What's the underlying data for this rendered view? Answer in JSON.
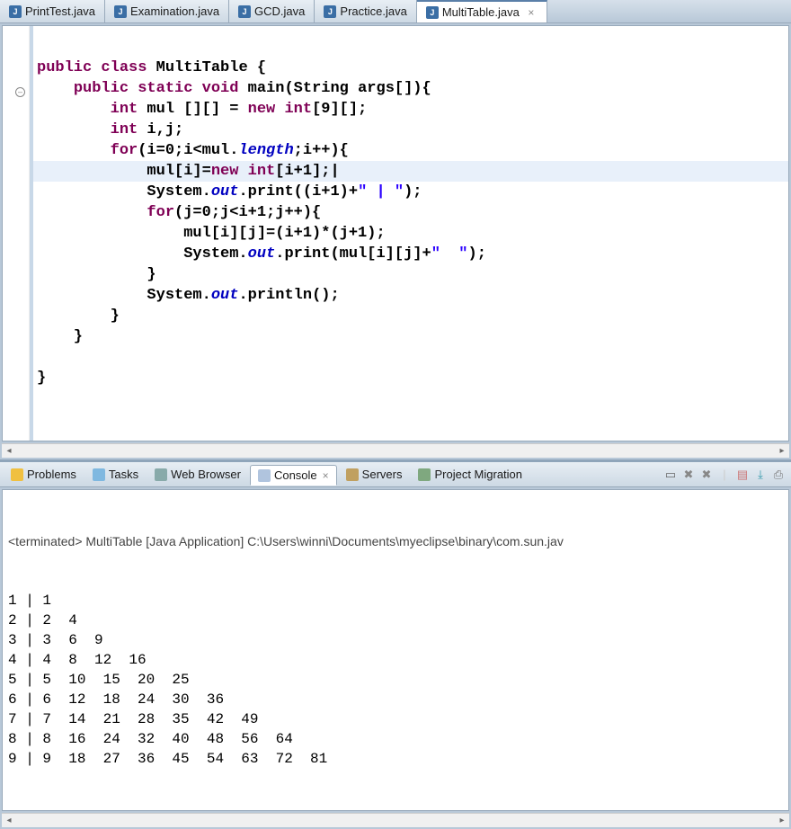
{
  "editor_tabs": [
    {
      "label": "PrintTest.java",
      "active": false
    },
    {
      "label": "Examination.java",
      "active": false
    },
    {
      "label": "GCD.java",
      "active": false
    },
    {
      "label": "Practice.java",
      "active": false
    },
    {
      "label": "MultiTable.java",
      "active": true
    }
  ],
  "code": {
    "lines": [
      [
        {
          "t": "plain",
          "s": ""
        }
      ],
      [
        {
          "t": "kw",
          "s": "public"
        },
        {
          "t": "plain",
          "s": " "
        },
        {
          "t": "kw",
          "s": "class"
        },
        {
          "t": "plain",
          "s": " MultiTable {"
        }
      ],
      [
        {
          "t": "plain",
          "s": "    "
        },
        {
          "t": "kw",
          "s": "public"
        },
        {
          "t": "plain",
          "s": " "
        },
        {
          "t": "kw",
          "s": "static"
        },
        {
          "t": "plain",
          "s": " "
        },
        {
          "t": "kw",
          "s": "void"
        },
        {
          "t": "plain",
          "s": " main(String args[]){"
        }
      ],
      [
        {
          "t": "plain",
          "s": "        "
        },
        {
          "t": "kw",
          "s": "int"
        },
        {
          "t": "plain",
          "s": " mul [][] = "
        },
        {
          "t": "kw",
          "s": "new"
        },
        {
          "t": "plain",
          "s": " "
        },
        {
          "t": "kw",
          "s": "int"
        },
        {
          "t": "plain",
          "s": "[9][];"
        }
      ],
      [
        {
          "t": "plain",
          "s": "        "
        },
        {
          "t": "kw",
          "s": "int"
        },
        {
          "t": "plain",
          "s": " i,j;"
        }
      ],
      [
        {
          "t": "plain",
          "s": "        "
        },
        {
          "t": "kw",
          "s": "for"
        },
        {
          "t": "plain",
          "s": "(i=0;i<mul."
        },
        {
          "t": "fld",
          "s": "length"
        },
        {
          "t": "plain",
          "s": ";i++){"
        }
      ],
      [
        {
          "t": "plain",
          "s": "            mul[i]="
        },
        {
          "t": "kw",
          "s": "new"
        },
        {
          "t": "plain",
          "s": " "
        },
        {
          "t": "kw",
          "s": "int"
        },
        {
          "t": "plain",
          "s": "[i+1];|"
        }
      ],
      [
        {
          "t": "plain",
          "s": "            System."
        },
        {
          "t": "fld",
          "s": "out"
        },
        {
          "t": "plain",
          "s": ".print((i+1)+"
        },
        {
          "t": "str",
          "s": "\" | \""
        },
        {
          "t": "plain",
          "s": ");"
        }
      ],
      [
        {
          "t": "plain",
          "s": "            "
        },
        {
          "t": "kw",
          "s": "for"
        },
        {
          "t": "plain",
          "s": "(j=0;j<i+1;j++){"
        }
      ],
      [
        {
          "t": "plain",
          "s": "                mul[i][j]=(i+1)*(j+1);"
        }
      ],
      [
        {
          "t": "plain",
          "s": "                System."
        },
        {
          "t": "fld",
          "s": "out"
        },
        {
          "t": "plain",
          "s": ".print(mul[i][j]+"
        },
        {
          "t": "str",
          "s": "\"  \""
        },
        {
          "t": "plain",
          "s": ");"
        }
      ],
      [
        {
          "t": "plain",
          "s": "            }"
        }
      ],
      [
        {
          "t": "plain",
          "s": "            System."
        },
        {
          "t": "fld",
          "s": "out"
        },
        {
          "t": "plain",
          "s": ".println();"
        }
      ],
      [
        {
          "t": "plain",
          "s": "        }"
        }
      ],
      [
        {
          "t": "plain",
          "s": "    }"
        }
      ],
      [
        {
          "t": "plain",
          "s": ""
        }
      ],
      [
        {
          "t": "plain",
          "s": "}"
        }
      ]
    ],
    "highlighted_line_index": 6
  },
  "bottom_tabs": [
    {
      "label": "Problems",
      "icon_bg": "#f0c040"
    },
    {
      "label": "Tasks",
      "icon_bg": "#7fb8e0"
    },
    {
      "label": "Web Browser",
      "icon_bg": "#8aa"
    },
    {
      "label": "Console",
      "icon_bg": "#b0c4de",
      "active": true
    },
    {
      "label": "Servers",
      "icon_bg": "#c0a060"
    },
    {
      "label": "Project Migration",
      "icon_bg": "#7fa87f"
    }
  ],
  "console": {
    "header": "<terminated> MultiTable [Java Application] C:\\Users\\winni\\Documents\\myeclipse\\binary\\com.sun.jav",
    "output": "1 | 1  \n2 | 2  4  \n3 | 3  6  9  \n4 | 4  8  12  16  \n5 | 5  10  15  20  25  \n6 | 6  12  18  24  30  36  \n7 | 7  14  21  28  35  42  49  \n8 | 8  16  24  32  40  48  56  64  \n9 | 9  18  27  36  45  54  63  72  81  "
  }
}
